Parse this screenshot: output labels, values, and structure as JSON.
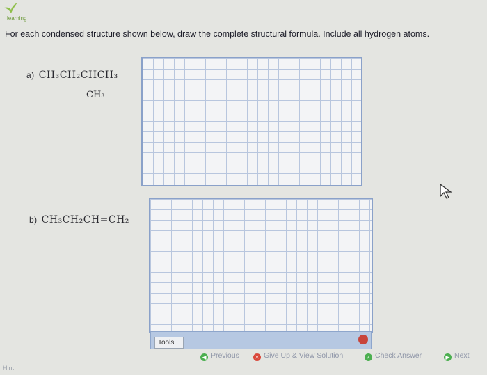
{
  "brand": {
    "name": "learning"
  },
  "instructions": "For each condensed structure shown below, draw the complete structural formula. Include all hydrogen atoms.",
  "questions": [
    {
      "label": "a)",
      "formula_main": "CH₃CH₂CHCH₃",
      "formula_branch": "CH₃"
    },
    {
      "label": "b)",
      "formula_main": "CH₃CH₂CH=CH₂"
    }
  ],
  "toolbar": {
    "tools_label": "Tools"
  },
  "nav": {
    "previous": "Previous",
    "give_up": "Give Up & View Solution",
    "check": "Check Answer",
    "next": "Next",
    "hint": "Hint"
  },
  "colors": {
    "grid_border": "#8aa1c9",
    "grid_line": "#b8c6de",
    "previous_icon": "#4caf50",
    "give_up_icon": "#d9473a",
    "check_icon": "#4caf50",
    "next_icon": "#4caf50"
  }
}
